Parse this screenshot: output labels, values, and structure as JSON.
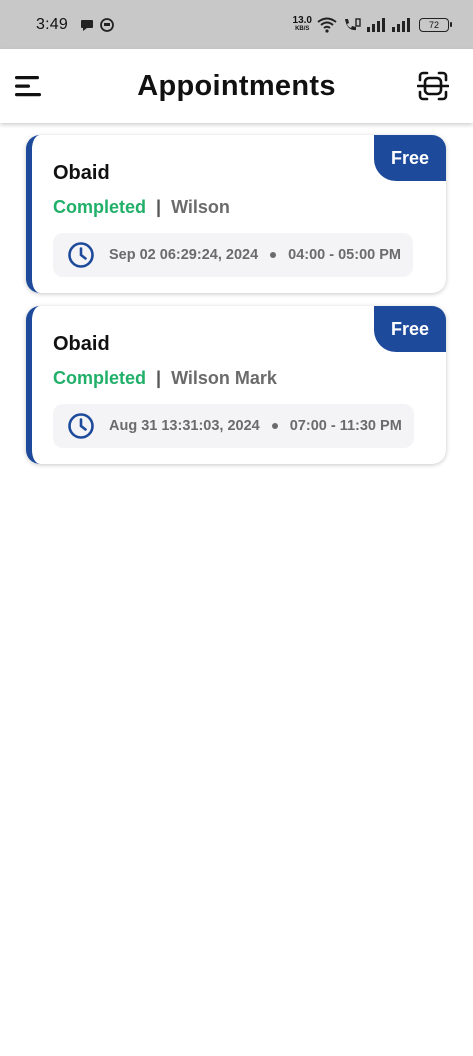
{
  "status_bar": {
    "time": "3:49",
    "net_speed_value": "13.0",
    "net_speed_unit": "KB/S",
    "battery": "72"
  },
  "header": {
    "title": "Appointments"
  },
  "appointments": [
    {
      "badge": "Free",
      "name": "Obaid",
      "status": "Completed",
      "separator": "|",
      "provider": "Wilson",
      "datetime": "Sep 02 06:29:24, 2024",
      "slot": "04:00 - 05:00 PM"
    },
    {
      "badge": "Free",
      "name": "Obaid",
      "status": "Completed",
      "separator": "|",
      "provider": "Wilson Mark",
      "datetime": "Aug 31 13:31:03, 2024",
      "slot": "07:00 - 11:30 PM"
    }
  ],
  "colors": {
    "accent": "#1e4a9c",
    "status_completed": "#21b06a",
    "status_bar_bg": "#c8c8c8"
  },
  "icons": {
    "menu": "menu-icon",
    "scan": "scan-icon",
    "clock": "clock-icon"
  }
}
